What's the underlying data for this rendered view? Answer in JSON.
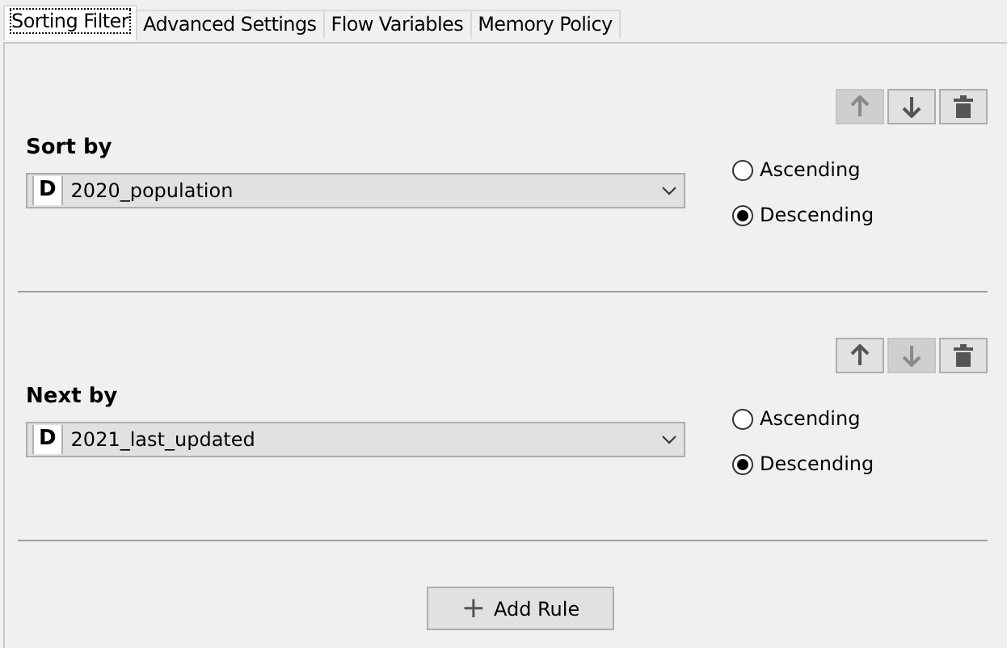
{
  "tabs": [
    {
      "label": "Sorting Filter",
      "selected": true
    },
    {
      "label": "Advanced Settings",
      "selected": false
    },
    {
      "label": "Flow Variables",
      "selected": false
    },
    {
      "label": "Memory Policy",
      "selected": false
    }
  ],
  "rules": [
    {
      "label": "Sort by",
      "column_type": "D",
      "column": "2020_population",
      "actions": [
        {
          "kind": "up",
          "disabled": true
        },
        {
          "kind": "down",
          "disabled": false
        },
        {
          "kind": "delete",
          "disabled": false
        }
      ],
      "orders": [
        {
          "label": "Ascending",
          "selected": false
        },
        {
          "label": "Descending",
          "selected": true
        }
      ]
    },
    {
      "label": "Next by",
      "column_type": "D",
      "column": "2021_last_updated",
      "actions": [
        {
          "kind": "up",
          "disabled": false
        },
        {
          "kind": "down",
          "disabled": true
        },
        {
          "kind": "delete",
          "disabled": false
        }
      ],
      "orders": [
        {
          "label": "Ascending",
          "selected": false
        },
        {
          "label": "Descending",
          "selected": true
        }
      ]
    }
  ],
  "add_button": {
    "icon": "+",
    "label": "Add Rule"
  }
}
